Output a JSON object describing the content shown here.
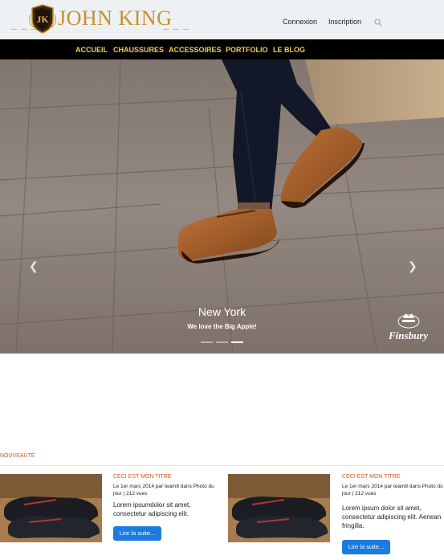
{
  "header": {
    "logo_text": "JOHN KING",
    "logo_dashes_left": "_ _ _",
    "logo_dashes_right": "_ _ _",
    "login_label": "Connexion",
    "signup_label": "Inscription",
    "search_icon": "search-icon"
  },
  "nav": {
    "items": [
      {
        "label": "ACCUEIL"
      },
      {
        "label": "CHAUSSURES"
      },
      {
        "label": "ACCESSOIRES"
      },
      {
        "label": "PORTFOLIO"
      },
      {
        "label": "LE BLOG"
      }
    ]
  },
  "hero": {
    "title": "New York",
    "subtitle": "We love the Big Apple!",
    "brand": "Finsbury",
    "prev_icon": "chevron-left-icon",
    "next_icon": "chevron-right-icon",
    "slides_count": 3,
    "active_slide": 3
  },
  "news": {
    "section_label": "NOUVEAUTÉ",
    "cards": [
      {
        "title": "CECI EST MON TITRE",
        "meta": "Le 1er mars 2014 par team8 dans Photo du jour | 212 vues",
        "excerpt": "Lorem ipsumdolor sit amet, consectetur adipiscing elit.",
        "button": "Lire la suite..."
      },
      {
        "title": "CECI EST MON TITRE",
        "meta": "Le 1er mars 2014 par team8 dans Photo du jour | 212 vues",
        "excerpt": "Lorem ipsum dolor sit amet, consectetur adipiscing elit. Aenean fringilla.",
        "button": "Lire la suite..."
      }
    ]
  },
  "colors": {
    "header_bg": "#eef1f3",
    "nav_bg": "#000000",
    "nav_text": "#f2cf5d",
    "logo_gold": "#c8902a",
    "accent_orange": "#d9541e",
    "button_blue": "#1a7be0"
  }
}
